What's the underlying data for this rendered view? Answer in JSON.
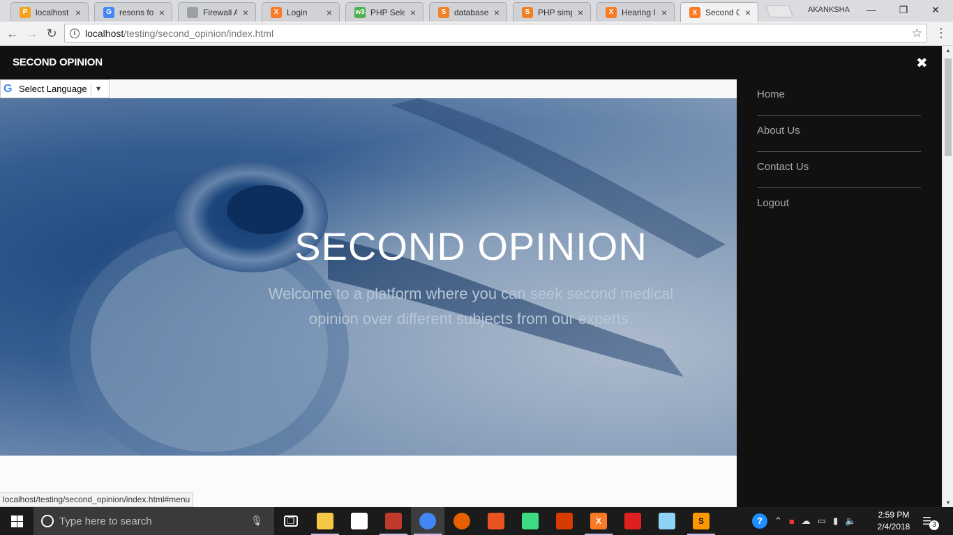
{
  "browser": {
    "tabs": [
      {
        "title": "localhost /",
        "icon": "phpmyadmin-icon",
        "color": "#f4a31b",
        "glyph": "P"
      },
      {
        "title": "resons for l",
        "icon": "google-icon",
        "color": "#4285f4",
        "glyph": "G"
      },
      {
        "title": "Firewall Au",
        "icon": "document-icon",
        "color": "#9aa0a6",
        "glyph": ""
      },
      {
        "title": "Login",
        "icon": "xampp-icon",
        "color": "#fb7a24",
        "glyph": "X"
      },
      {
        "title": "PHP Select",
        "icon": "w3schools-icon",
        "color": "#4caf50",
        "glyph": "w3"
      },
      {
        "title": "database -",
        "icon": "stackoverflow-icon",
        "color": "#f48024",
        "glyph": "S"
      },
      {
        "title": "PHP simple",
        "icon": "stackoverflow-icon",
        "color": "#f48024",
        "glyph": "S"
      },
      {
        "title": "Hearing Im",
        "icon": "xampp-icon",
        "color": "#fb7a24",
        "glyph": "X"
      },
      {
        "title": "Second Op",
        "icon": "xampp-icon",
        "color": "#fb7a24",
        "glyph": "X"
      }
    ],
    "active_tab": 8,
    "profile_name": "AKANKSHA",
    "url_host": "localhost",
    "url_path": "/testing/second_opinion/index.html"
  },
  "site": {
    "logo": "SECOND OPINION",
    "close_symbol": "✖",
    "translate_label": "Select Language",
    "hero_title": "SECOND OPINION",
    "hero_subtitle": "Welcome to a platform where you can seek second medical opinion over different subjects from our experts.",
    "menu": [
      "Home",
      "About Us",
      "Contact Us",
      "Logout"
    ]
  },
  "status_url": "localhost/testing/second_opinion/index.html#menu",
  "taskbar": {
    "search_placeholder": "Type here to search",
    "apps": [
      {
        "name": "task-view",
        "color": "#1b1b1b",
        "glyph": "❐",
        "running": false
      },
      {
        "name": "file-explorer",
        "color": "#f6c744",
        "glyph": "",
        "running": true
      },
      {
        "name": "store",
        "color": "#ffffff",
        "glyph": "",
        "running": false
      },
      {
        "name": "snipping-tool",
        "color": "#c0392b",
        "glyph": "",
        "running": true
      },
      {
        "name": "chrome",
        "color": "#4285f4",
        "glyph": "",
        "running": true
      },
      {
        "name": "firefox",
        "color": "#e66000",
        "glyph": "",
        "running": false
      },
      {
        "name": "ubuntu-app",
        "color": "#e95420",
        "glyph": "",
        "running": false
      },
      {
        "name": "android-studio",
        "color": "#3ddc84",
        "glyph": "",
        "running": false
      },
      {
        "name": "office-app",
        "color": "#d83b01",
        "glyph": "",
        "running": false
      },
      {
        "name": "xampp",
        "color": "#fb7a24",
        "glyph": "X",
        "running": true
      },
      {
        "name": "acrobat",
        "color": "#e02020",
        "glyph": "",
        "running": false
      },
      {
        "name": "notepad-app",
        "color": "#8fd3f4",
        "glyph": "",
        "running": false
      },
      {
        "name": "sublime-text",
        "color": "#ff9800",
        "glyph": "S",
        "running": true
      }
    ],
    "time": "2:59 PM",
    "date": "2/4/2018",
    "notification_count": "3"
  }
}
